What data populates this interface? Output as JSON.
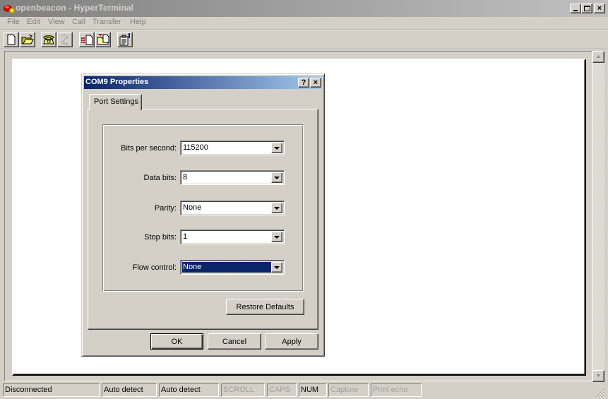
{
  "window": {
    "title": "openbeacon - HyperTerminal",
    "controls": {
      "minimize": "_",
      "maximize": "□",
      "close": "×"
    }
  },
  "menu": [
    "File",
    "Edit",
    "View",
    "Call",
    "Transfer",
    "Help"
  ],
  "toolbar": [
    {
      "name": "new-icon",
      "tooltip": "New"
    },
    {
      "name": "open-icon",
      "tooltip": "Open"
    },
    {
      "name": "call-icon",
      "tooltip": "Call"
    },
    {
      "name": "disconnect-icon",
      "tooltip": "Disconnect"
    },
    {
      "name": "send-icon",
      "tooltip": "Send"
    },
    {
      "name": "receive-icon",
      "tooltip": "Receive"
    },
    {
      "name": "properties-icon",
      "tooltip": "Properties"
    }
  ],
  "dialog": {
    "title": "COM9 Properties",
    "help_button": "?",
    "close_button": "×",
    "tab": "Port Settings",
    "fields": [
      {
        "label": "Bits per second:",
        "value": "115200"
      },
      {
        "label": "Data bits:",
        "value": "8"
      },
      {
        "label": "Parity:",
        "value": "None"
      },
      {
        "label": "Stop bits:",
        "value": "1"
      },
      {
        "label": "Flow control:",
        "value": "None",
        "selected": true
      }
    ],
    "restore_defaults": "Restore Defaults",
    "ok": "OK",
    "cancel": "Cancel",
    "apply": "Apply"
  },
  "status": {
    "connection": "Disconnected",
    "detect1": "Auto detect",
    "detect2": "Auto detect",
    "scroll": "SCROLL",
    "caps": "CAPS",
    "num": "NUM",
    "capture": "Capture",
    "print_echo": "Print echo"
  },
  "colors": {
    "dialog_title_start": "#0a246a",
    "dialog_title_end": "#a6caf0",
    "selection": "#0a246a",
    "face": "#d4d0c8"
  }
}
